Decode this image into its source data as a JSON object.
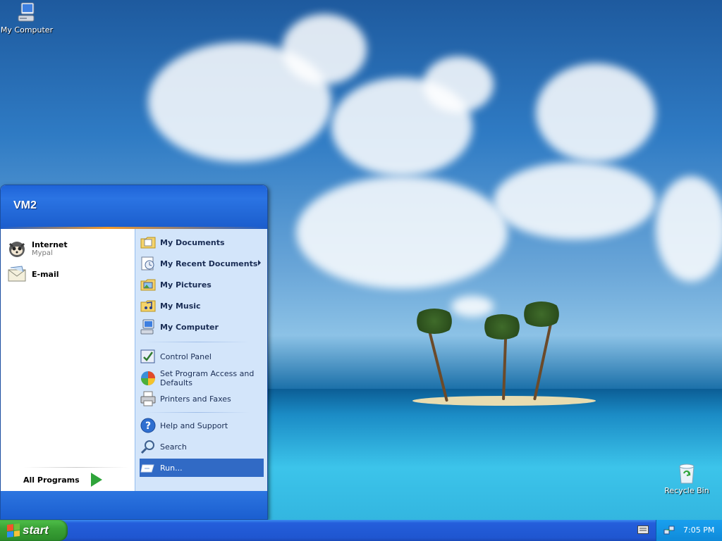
{
  "desktop": {
    "icons": [
      {
        "label": "My Computer",
        "icon": "my-computer-icon"
      },
      {
        "label": "Recycle Bin",
        "icon": "recycle-bin-icon"
      }
    ]
  },
  "start_menu": {
    "user_name": "VM2",
    "pinned": [
      {
        "title": "Internet",
        "subtitle": "Mypal",
        "icon": "mypal-browser-icon"
      },
      {
        "title": "E-mail",
        "subtitle": "",
        "icon": "email-icon"
      }
    ],
    "all_programs_label": "All Programs",
    "places": [
      {
        "label": "My Documents",
        "icon": "my-documents-icon"
      },
      {
        "label": "My Recent Documents",
        "icon": "recent-documents-icon"
      },
      {
        "label": "My Pictures",
        "icon": "my-pictures-icon"
      },
      {
        "label": "My Music",
        "icon": "my-music-icon"
      },
      {
        "label": "My Computer",
        "icon": "my-computer-icon"
      }
    ],
    "settings": [
      {
        "label": "Control Panel",
        "icon": "control-panel-icon"
      },
      {
        "label": "Set Program Access and Defaults",
        "icon": "program-access-icon"
      },
      {
        "label": "Printers and Faxes",
        "icon": "printer-icon"
      }
    ],
    "tools": [
      {
        "label": "Help and Support",
        "icon": "help-icon"
      },
      {
        "label": "Search",
        "icon": "search-icon"
      },
      {
        "label": "Run...",
        "icon": "run-icon"
      }
    ]
  },
  "taskbar": {
    "start_label": "start",
    "clock": "7:05 PM"
  },
  "colors": {
    "taskbar_blue": "#245edb",
    "start_green": "#3aa236",
    "menu_header_blue": "#1e63d8",
    "selection_blue": "#316ac5"
  }
}
